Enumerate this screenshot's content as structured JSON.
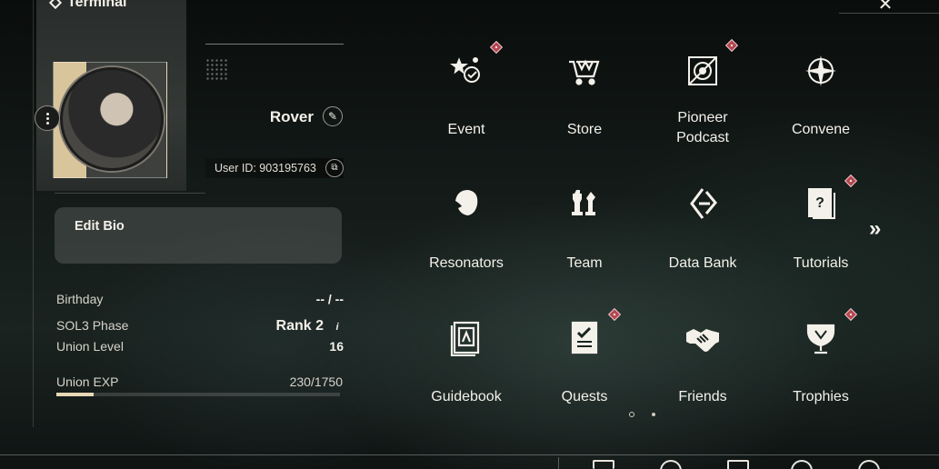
{
  "header": {
    "title": "Terminal"
  },
  "profile": {
    "username": "Rover",
    "user_id": "User ID: 903195763",
    "bio_label": "Edit Bio",
    "stats": [
      {
        "label": "Birthday",
        "value": "-- / --"
      },
      {
        "label": "SOL3 Phase",
        "value": "Rank 2"
      },
      {
        "label": "Union Level",
        "value": "16"
      }
    ],
    "exp": {
      "label": "Union EXP",
      "value": "230/1750",
      "current": 230,
      "max": 1750
    }
  },
  "menu": {
    "tiles": [
      {
        "label": "Event",
        "icon": "event-icon",
        "badge": true
      },
      {
        "label": "Store",
        "icon": "store-cart-icon",
        "badge": false
      },
      {
        "label": "Pioneer\nPodcast",
        "label_line1": "Pioneer",
        "label_line2": "Podcast",
        "icon": "podcast-icon",
        "badge": true
      },
      {
        "label": "Convene",
        "icon": "convene-star-icon",
        "badge": false
      },
      {
        "label": "Resonators",
        "icon": "resonators-icon",
        "badge": false
      },
      {
        "label": "Team",
        "icon": "team-chess-icon",
        "badge": false
      },
      {
        "label": "Data Bank",
        "icon": "data-bank-icon",
        "badge": false
      },
      {
        "label": "Tutorials",
        "icon": "tutorials-icon",
        "badge": true
      },
      {
        "label": "Guidebook",
        "icon": "guidebook-icon",
        "badge": false
      },
      {
        "label": "Quests",
        "icon": "quests-icon",
        "badge": true
      },
      {
        "label": "Friends",
        "icon": "handshake-icon",
        "badge": false
      },
      {
        "label": "Trophies",
        "icon": "trophy-icon",
        "badge": true
      }
    ],
    "next_page": "»",
    "pages": 2,
    "current_page": 1
  },
  "colors": {
    "badge": "#b4464f",
    "accent": "#e6d7b6",
    "text": "#f4f1ea"
  }
}
